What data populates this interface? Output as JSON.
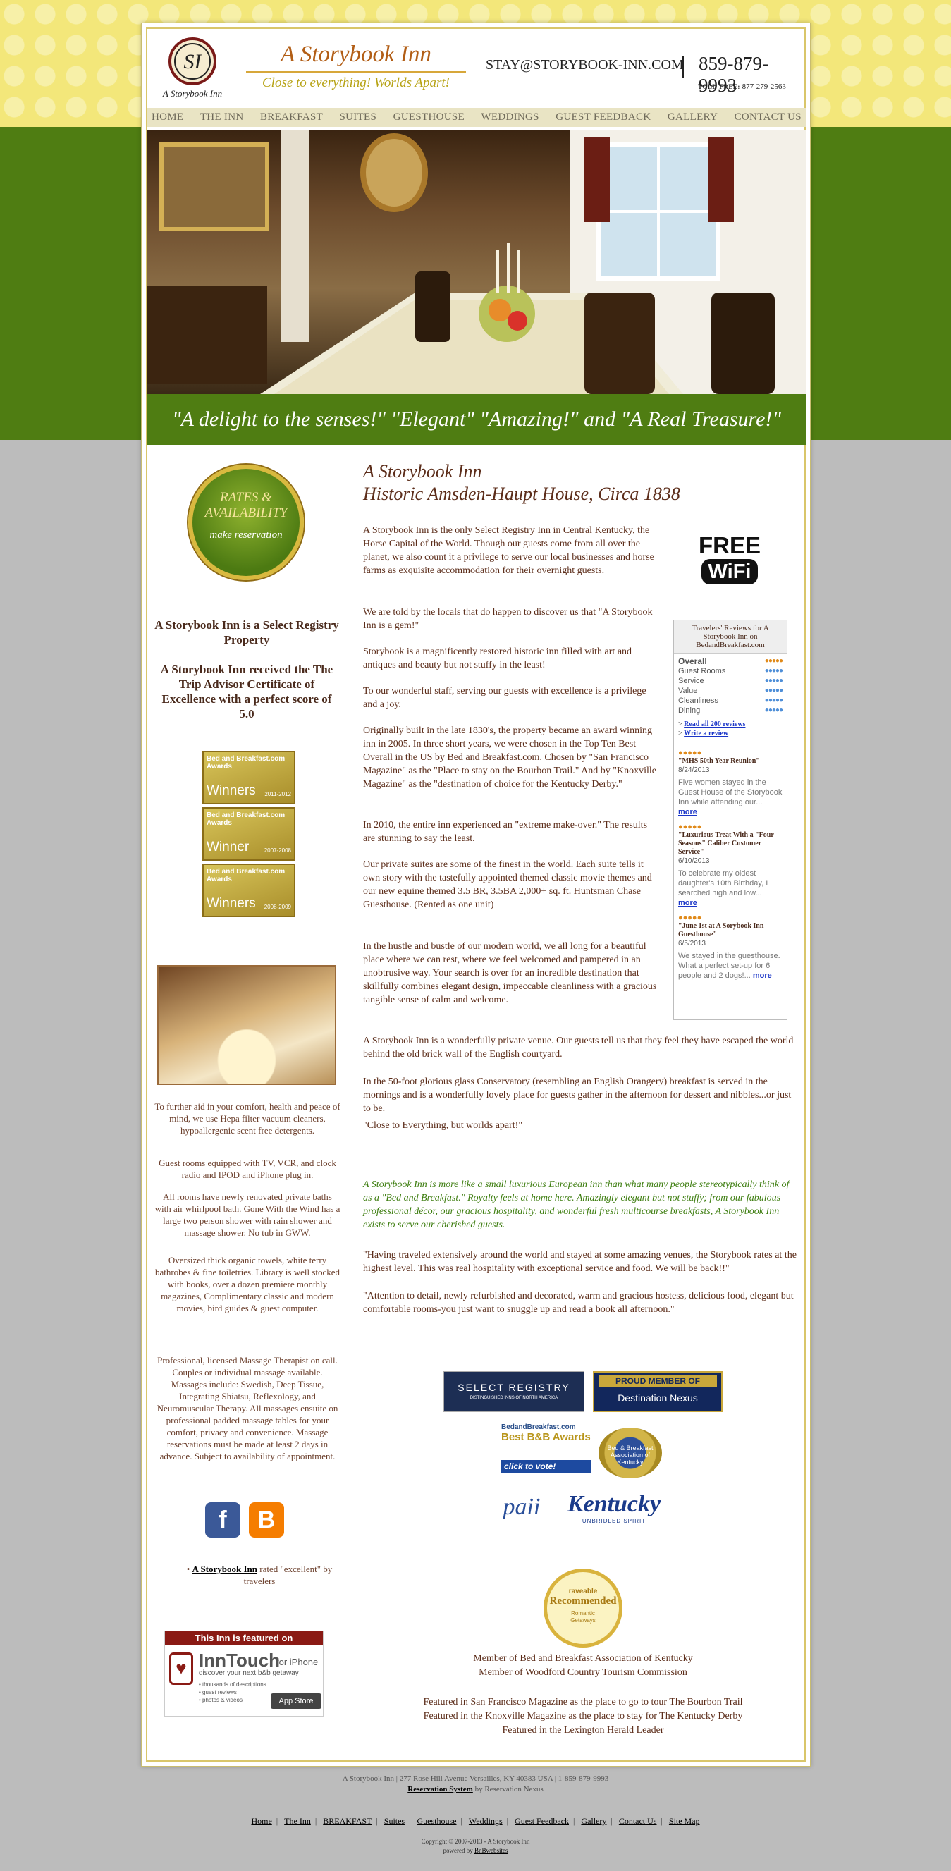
{
  "header": {
    "logo_text": "A Storybook Inn",
    "site_title": "A Storybook Inn",
    "tagline": "Close to everything!  Worlds Apart!",
    "email": "STAY@STORYBOOK-INN.COM",
    "phone": "859-879-9993",
    "tollfree_label": "TOLL-FREE:",
    "tollfree_number": "877-279-2563"
  },
  "nav": [
    "HOME",
    "THE INN",
    "BREAKFAST",
    "SUITES",
    "GUESTHOUSE",
    "WEDDINGS",
    "GUEST FEEDBACK",
    "GALLERY",
    "CONTACT US"
  ],
  "hero": {
    "caption": "\"A delight to the senses!\" \"Elegant\" \"Amazing!\" and \"A Real Treasure!\""
  },
  "left": {
    "rates_line1": "RATES &",
    "rates_line2": "AVAILABILITY",
    "rates_line3": "make reservation",
    "select_registry": "A Storybook Inn is a Select Registry Property",
    "tripadvisor": "A Storybook Inn received the The Trip Advisor Certificate of Excellence with a perfect score of 5.0",
    "awards": [
      {
        "brand": "Bed and Breakfast.com Awards",
        "label": "Winners",
        "years": "2011-2012"
      },
      {
        "brand": "Bed and Breakfast.com Awards",
        "label": "Winner",
        "years": "2007-2008"
      },
      {
        "brand": "Bed and Breakfast.com Awards",
        "label": "Winners",
        "years": "2008-2009"
      }
    ],
    "para1": "To further aid in your comfort, health and peace of mind, we use Hepa filter vacuum cleaners, hypoallergenic scent free detergents.",
    "para2": "Guest rooms equipped with TV, VCR, and clock radio and IPOD and iPhone plug in.",
    "para3": "All rooms have newly renovated private baths with air whirlpool bath. Gone With the Wind has a large two person shower with rain shower and massage shower. No tub in GWW.",
    "para4": "Oversized thick organic towels, white terry bathrobes & fine toiletries. Library is well stocked with books, over a dozen premiere monthly magazines, Complimentary classic and modern movies, bird guides & guest computer.",
    "para5": "Professional, licensed Massage Therapist on call. Couples or individual massage available. Massages include: Swedish, Deep Tissue, Integrating Shiatsu, Reflexology, and Neuromuscular Therapy. All massages ensuite on professional padded massage tables for your comfort, privacy and convenience. Massage reservations must be made at least 2 days in advance. Subject to availability of appointment.",
    "facebook_glyph": "f",
    "blogger_glyph": "B",
    "rated_link": "A Storybook Inn",
    "rated_text": " rated \"excellent\" by travelers",
    "inntouch": {
      "banner": "This Inn is featured on",
      "brand": "InnTouch",
      "for_iphone": "for iPhone",
      "sub": "discover your next b&b getaway",
      "bullets": [
        "• thousands of descriptions",
        "• guest reviews",
        "• photos & videos"
      ],
      "appstore": "App Store"
    }
  },
  "main": {
    "title_line1": "A Storybook Inn",
    "title_line2": "Historic Amsden-Haupt House, Circa 1838",
    "p1": "A Storybook Inn is the only Select Registry Inn in Central Kentucky, the Horse Capital of the World. Though our guests come from all over the planet, we also count it a privilege to serve our local businesses and horse farms as exquisite accommodation for their overnight guests.",
    "p2": "We are told by the locals that do happen to discover us that \"A Storybook Inn is a gem!\"",
    "p3": "Storybook is a magnificently restored historic inn filled with art and antiques and beauty but not stuffy in the least!",
    "p4": "To our wonderful staff, serving our guests with excellence is a privilege and a joy.",
    "p5": "Originally built in the late 1830's, the property became an award winning inn in 2005. In three short years, we were chosen in the Top Ten Best Overall in the US by Bed and Breakfast.com. Chosen by \"San Francisco Magazine\" as the \"Place to stay on the Bourbon Trail.\" And by \"Knoxville Magazine\" as the \"destination of choice for the Kentucky Derby.\"",
    "p6": "In 2010, the entire inn experienced an \"extreme make-over.\" The results are stunning to say the least.",
    "p7": "Our private suites are some of the finest in the world. Each suite tells it own story with the tastefully appointed themed classic movie themes and our new equine themed 3.5 BR, 3.5BA 2,000+ sq. ft. Huntsman Chase Guesthouse. (Rented as one unit)",
    "p8": "In the hustle and bustle of our modern world, we all long for a beautiful place where we can rest, where we feel welcomed and pampered in an unobtrusive way. Your search is over for an incredible destination that skillfully combines elegant design, impeccable cleanliness with a gracious tangible sense of calm and welcome.",
    "p9": "A Storybook Inn is a wonderfully private venue. Our guests tell us that they feel they have escaped the world behind the old brick wall of the English courtyard.",
    "p10": "In the 50-foot glorious glass Conservatory (resembling an English Orangery) breakfast is served in the mornings and is a wonderfully lovely place for guests gather in the afternoon for dessert and nibbles...or just to be.",
    "p11": "\"Close to Everything, but worlds apart!\"",
    "p12": "A Storybook Inn is more like a small luxurious European inn than what many people stereotypically think of as a \"Bed and Breakfast.\" Royalty feels at home here. Amazingly elegant but not stuffy; from our fabulous professional décor, our gracious hospitality, and wonderful fresh multicourse breakfasts, A Storybook Inn exists to serve our cherished guests.",
    "p13": "\"Having traveled extensively around the world and stayed at some amazing venues, the Storybook rates at the highest level. This was real hospitality with exceptional service and food. We will be back!!\"",
    "p14": "\"Attention to detail, newly refurbished and decorated, warm and gracious hostess, delicious food, elegant but comfortable rooms-you just want to snuggle up and read a book all afternoon.\"",
    "wifi_free": "FREE",
    "wifi_label": "WiFi"
  },
  "reviews": {
    "header": "Travelers' Reviews for A Storybook Inn on BedandBreakfast.com",
    "categories": [
      "Overall",
      "Guest Rooms",
      "Service",
      "Value",
      "Cleanliness",
      "Dining"
    ],
    "read_all": "Read all 200 reviews",
    "write": "Write a review",
    "items": [
      {
        "title": "\"MHS 50th Year Reunion\"",
        "date": "8/24/2013",
        "body": "Five women stayed in the Guest House of the Storybook Inn while attending our... ",
        "more": "more"
      },
      {
        "title": "\"Luxurious Treat With a \"Four Seasons\" Caliber Customer Service\"",
        "date": "6/10/2013",
        "body": "To celebrate my oldest daughter's 10th Birthday, I searched high and low... ",
        "more": "more"
      },
      {
        "title": "\"June 1st at A Sorybook Inn Guesthouse\"",
        "date": "6/5/2013",
        "body": "We stayed in the guesthouse. What a perfect set-up for 6 people and 2 dogs!... ",
        "more": "more"
      }
    ]
  },
  "badges": {
    "select_registry": "SELECT REGISTRY",
    "select_registry_sub": "DISTINGUISHED INNS OF NORTH AMERICA",
    "proud_member": "PROUD MEMBER OF",
    "dest_nexus": "Destination Nexus",
    "bb_awards_brand": "BedandBreakfast.com",
    "bb_awards_title": "Best B&B Awards",
    "bb_awards_vote": "click to vote!",
    "bb_assoc": "Bed & Breakfast Association of Kentucky",
    "paii": "paii",
    "kentucky": "Kentucky",
    "kentucky_sub": "UNBRIDLED SPIRIT",
    "raveable1": "raveable",
    "raveable2": "Recommended",
    "raveable3": "Romantic Getaways"
  },
  "bottom": {
    "line1": "Member of Bed and Breakfast Association of Kentucky",
    "line2": "Member of Woodford Country Tourism Commission",
    "line3": "Featured in San Francisco Magazine as the place to go to tour The Bourbon Trail",
    "line4": "Featured in the Knoxville Magazine as the place to stay for The Kentucky Derby",
    "line5": "Featured in the Lexington Herald Leader"
  },
  "footer": {
    "address": "A Storybook Inn | 277 Rose Hill Avenue Versailles, KY 40383 USA | 1-859-879-9993",
    "reservation_link": "Reservation System",
    "reservation_by": " by Reservation Nexus",
    "links": [
      "Home",
      "The Inn",
      "BREAKFAST",
      "Suites",
      "Guesthouse",
      "Weddings",
      "Guest Feedback",
      "Gallery",
      "Contact Us",
      "Site Map"
    ],
    "copyright": "Copyright © 2007-2013 - A Storybook Inn",
    "powered": "powered by ",
    "powered_link": "BnBwebsites"
  }
}
